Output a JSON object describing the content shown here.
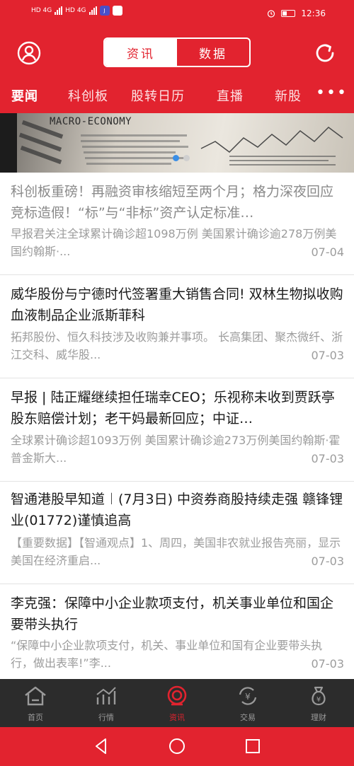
{
  "status_bar": {
    "signal1": "HD 4G",
    "signal2": "HD 4G",
    "time": "12:36"
  },
  "header": {
    "tabs": [
      {
        "label": "资讯",
        "active": true
      },
      {
        "label": "数据",
        "active": false
      }
    ],
    "categories": [
      "要闻",
      "科创板",
      "股转日历",
      "直播",
      "新股"
    ],
    "more_label": "•••"
  },
  "banner": {
    "text": "MACRO-ECONOMY",
    "slide_count": 2,
    "active_slide": 1
  },
  "news": [
    {
      "title": "科创板重磅！再融资审核缩短至两个月；格力深夜回应竞标造假！“标”与“非标”资产认定标准…",
      "summary": "早报君关注全球累计确诊超1098万例 美国累计确诊逾278万例美国约翰斯·...",
      "date": "07-04",
      "read": true
    },
    {
      "title": "威华股份与宁德时代签署重大销售合同! 双林生物拟收购血液制品企业派斯菲科",
      "summary": "拓邦股份、恒久科技涉及收购兼并事项。 长高集团、聚杰微纤、浙江交科、威华股...",
      "date": "07-03",
      "read": false
    },
    {
      "title": "早报 | 陆正耀继续担任瑞幸CEO；乐视称未收到贾跃亭股东赔偿计划；老干妈最新回应；中证…",
      "summary": "全球累计确诊超1093万例 美国累计确诊逾273万例美国约翰斯·霍普金斯大...",
      "date": "07-03",
      "read": false
    },
    {
      "title": "智通港股早知道︱(7月3日) 中资券商股持续走强 赣锋锂业(01772)谨慎追高",
      "summary": "【重要数据】【智通观点】1、周四，美国非农就业报告亮丽，显示美国在经济重启...",
      "date": "07-03",
      "read": false
    },
    {
      "title": "李克强：保障中小企业款项支付，机关事业单位和国企要带头执行",
      "summary": "“保障中小企业款项支付，机关、事业单位和国有企业要带头执行，做出表率!”李...",
      "date": "07-03",
      "read": false
    }
  ],
  "bottom_nav": [
    {
      "label": "首页",
      "icon": "home-icon",
      "active": false
    },
    {
      "label": "行情",
      "icon": "chart-icon",
      "active": false
    },
    {
      "label": "资讯",
      "icon": "news-icon",
      "active": true
    },
    {
      "label": "交易",
      "icon": "trade-icon",
      "active": false
    },
    {
      "label": "理财",
      "icon": "wealth-icon",
      "active": false
    }
  ],
  "colors": {
    "brand_red": "#e2232f",
    "tabbar_bg": "#2c2c2c",
    "accent_blue": "#3a8ee6"
  }
}
